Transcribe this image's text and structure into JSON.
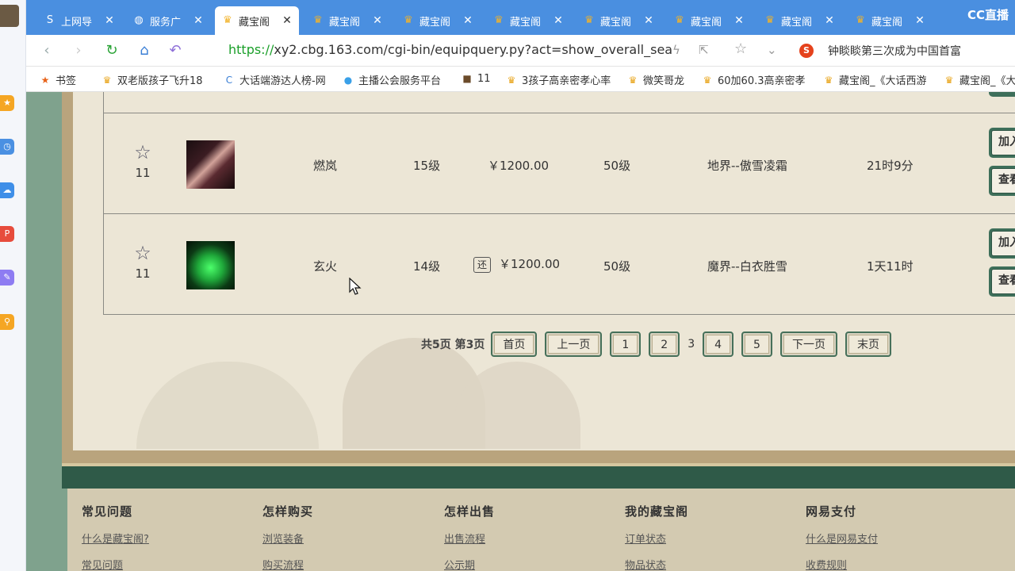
{
  "browser": {
    "tabs": [
      {
        "label": "上网导",
        "icon": "safe-browser-icon"
      },
      {
        "label": "服务广",
        "icon": "globe-icon"
      },
      {
        "label": "藏宝阁",
        "icon": "cbg-logo-icon",
        "active": true
      },
      {
        "label": "藏宝阁",
        "icon": "cbg-logo-icon"
      },
      {
        "label": "藏宝阁",
        "icon": "cbg-logo-icon"
      },
      {
        "label": "藏宝阁",
        "icon": "cbg-logo-icon"
      },
      {
        "label": "藏宝阁",
        "icon": "cbg-logo-icon"
      },
      {
        "label": "藏宝阁",
        "icon": "cbg-logo-icon"
      },
      {
        "label": "藏宝阁",
        "icon": "cbg-logo-icon"
      },
      {
        "label": "藏宝阁",
        "icon": "cbg-logo-icon"
      }
    ],
    "cc_logo": "CC直播",
    "url_scheme": "https://",
    "url_rest": "xy2.cbg.163.com/cgi-bin/equipquery.py?act=show_overall_sea",
    "search_text": "钟睒睒第三次成为中国首富",
    "bookmarks": [
      "书签",
      "双老版孩子飞升18",
      "大话端游达人榜-网",
      "主播公会服务平台",
      "11",
      "3孩子高亲密孝心率",
      "微笑哥龙",
      "60加60.3高亲密孝",
      "藏宝阁_《大话西游",
      "藏宝阁_《大"
    ]
  },
  "listings": [
    {
      "fav_count": "11",
      "name": "燃岚",
      "level": "15级",
      "price": "￥1200.00",
      "bargain": "",
      "char_level": "50级",
      "server": "地界--傲雪凌霜",
      "time_left": "21时9分",
      "btn_add": "加入",
      "btn_view": "查看"
    },
    {
      "fav_count": "11",
      "name": "玄火",
      "level": "14级",
      "price": "￥1200.00",
      "bargain": "还",
      "char_level": "50级",
      "server": "魔界--白衣胜雪",
      "time_left": "1天11时",
      "btn_add": "加入",
      "btn_view": "查看"
    }
  ],
  "pagination": {
    "info": "共5页 第3页",
    "first": "首页",
    "prev": "上一页",
    "pages": [
      "1",
      "2",
      "3",
      "4",
      "5"
    ],
    "current": "3",
    "next": "下一页",
    "last": "末页"
  },
  "footer": {
    "columns": [
      {
        "title": "常见问题",
        "links": [
          "什么是藏宝阁?",
          "常见问题"
        ]
      },
      {
        "title": "怎样购买",
        "links": [
          "浏览装备",
          "购买流程"
        ]
      },
      {
        "title": "怎样出售",
        "links": [
          "出售流程",
          "公示期"
        ]
      },
      {
        "title": "我的藏宝阁",
        "links": [
          "订单状态",
          "物品状态"
        ]
      },
      {
        "title": "网易支付",
        "links": [
          "什么是网易支付",
          "收费规则"
        ]
      }
    ]
  }
}
